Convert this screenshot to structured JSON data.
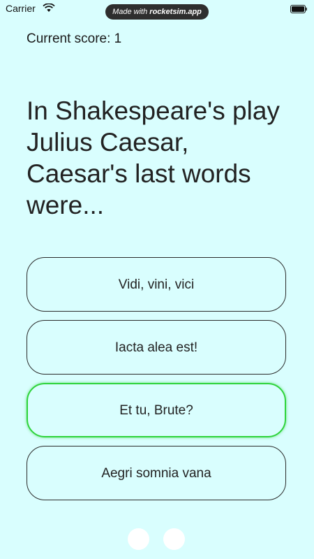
{
  "status_bar": {
    "carrier": "Carrier",
    "wifi_icon": "wifi-icon",
    "battery_icon": "battery-icon",
    "recording_pill": {
      "prefix": "Made with ",
      "brand": "rocketsim.app"
    }
  },
  "score": {
    "text": "Current score: 1"
  },
  "question": {
    "text": "In Shakespeare's play Julius Caesar, Caesar's last words were..."
  },
  "answers": [
    {
      "label": "Vidi, vini, vici",
      "state": "default"
    },
    {
      "label": "Iacta alea est!",
      "state": "default"
    },
    {
      "label": "Et tu, Brute?",
      "state": "correct"
    },
    {
      "label": "Aegri somnia vana",
      "state": "default"
    }
  ],
  "colors": {
    "background": "#d9fefe",
    "correct_border": "#2ed33a",
    "default_border": "#2a2a2a",
    "pill_background": "#2e2e2e"
  }
}
